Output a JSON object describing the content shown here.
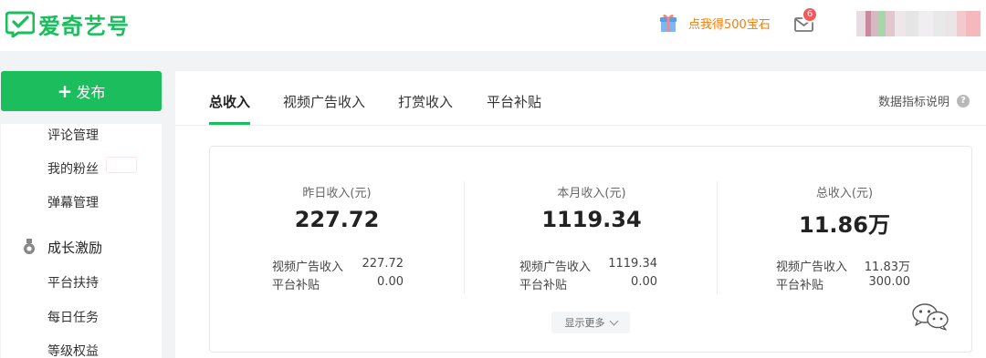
{
  "brand": {
    "name": "爱奇艺号",
    "color": "#1cbd5d",
    "logo_icon": "checkbox-chat-icon"
  },
  "header": {
    "gift_text": "点我得500宝石",
    "gift_icon": "gift-icon",
    "mail_icon": "mail-icon",
    "mail_badge": "6",
    "user_name_obscured": true
  },
  "sidebar": {
    "publish_label": "发布",
    "items": [
      {
        "label": "评论管理"
      },
      {
        "label": "我的粉丝"
      },
      {
        "label": "弹幕管理"
      },
      {
        "label": "平台扶持"
      },
      {
        "label": "每日任务"
      },
      {
        "label": "等级权益"
      }
    ],
    "section": {
      "label": "成长激励",
      "icon": "medal-icon"
    }
  },
  "tabs": [
    {
      "label": "总收入",
      "active": true
    },
    {
      "label": "视频广告收入",
      "active": false
    },
    {
      "label": "打赏收入",
      "active": false
    },
    {
      "label": "平台补贴",
      "active": false
    }
  ],
  "metric_doc": {
    "label": "数据指标说明",
    "icon": "question-icon"
  },
  "summary": {
    "columns": [
      {
        "title": "昨日收入(元)",
        "value": "227.72",
        "rows": [
          {
            "label": "视频广告收入",
            "value": "227.72"
          },
          {
            "label": "平台补贴",
            "value": "0.00"
          }
        ]
      },
      {
        "title": "本月收入(元)",
        "value": "1119.34",
        "rows": [
          {
            "label": "视频广告收入",
            "value": "1119.34"
          },
          {
            "label": "平台补贴",
            "value": "0.00"
          }
        ]
      },
      {
        "title": "总收入(元)",
        "value": "11.86万",
        "rows": [
          {
            "label": "视频广告收入",
            "value": "11.83万"
          },
          {
            "label": "平台补贴",
            "value": "300.00"
          }
        ]
      }
    ],
    "show_more": "显示更多"
  },
  "watermark": {
    "icon": "wechat-icon"
  },
  "colors": {
    "accent": "#1cbd5d",
    "orange": "#ff7a00",
    "badge": "#f05a5a",
    "background": "#f2f3f5"
  }
}
